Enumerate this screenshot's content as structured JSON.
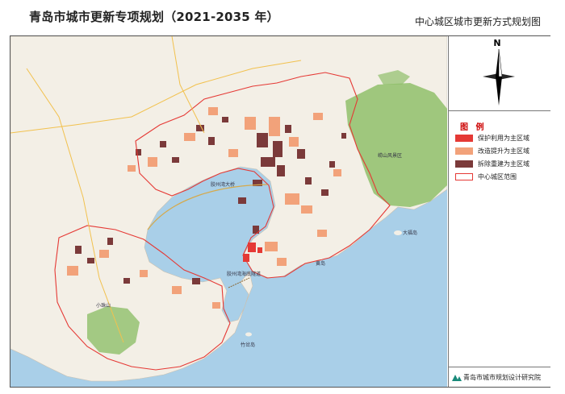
{
  "header": {
    "title": "青岛市城市更新专项规划（2021-2035 年）",
    "subtitle": "中心城区城市更新方式规划图"
  },
  "compass": {
    "label": "N"
  },
  "legend": {
    "title": "图 例",
    "items": [
      {
        "label": "保护利用为主区域",
        "color": "#e53935",
        "style": "fill"
      },
      {
        "label": "改造提升为主区域",
        "color": "#f2a27a",
        "style": "fill"
      },
      {
        "label": "拆除重建为主区域",
        "color": "#7b3a3a",
        "style": "fill"
      },
      {
        "label": "中心城区范围",
        "color": "#e53935",
        "style": "outline"
      }
    ]
  },
  "footer": {
    "org": "青岛市城市规划设计研究院"
  },
  "map_labels": {
    "bridge": "胶州湾大桥",
    "tunnel": "胶州湾海底隧道",
    "bay_island_1": "大福岛",
    "bay_island_2": "黄岛",
    "island_south": "竹岔岛",
    "mountain": "小珠山",
    "laoshan": "崂山风景区"
  },
  "colors": {
    "sea": "#a9cfe8",
    "land": "#f3efe6",
    "forest": "#8fbf6a",
    "boundary": "#e53935"
  }
}
